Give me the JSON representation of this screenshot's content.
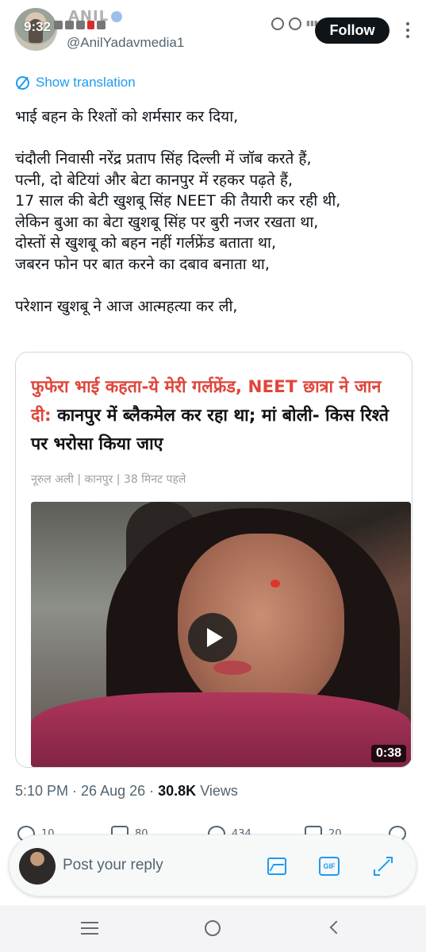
{
  "status_bar": {
    "time": "9:32"
  },
  "author": {
    "display_name": "ANIL",
    "handle": "@AnilYadavmedia1",
    "follow_label": "Follow"
  },
  "translation": {
    "label": "Show translation"
  },
  "tweet": {
    "lines": [
      "भाई बहन के रिश्तों को शर्मसार कर दिया,",
      "",
      "चंदौली निवासी नरेंद्र प्रताप सिंह दिल्ली में जॉब करते हैं,",
      "पत्नी, दो बेटियां और बेटा कानपुर में रहकर पढ़ते हैं,",
      "17 साल की बेटी खुशबू सिंह NEET की तैयारी कर रही थी,",
      "लेकिन बुआ का बेटा खुशबू सिंह पर बुरी नजर रखता था,",
      "दोस्तों से खुशबू को बहन नहीं गर्लफ्रेंड बताता था,",
      "जबरन फोन पर बात करने का दबाव बनाता था,",
      "",
      "परेशान खुशबू ने आज आत्महत्या कर ली,"
    ]
  },
  "card": {
    "headline_red": "फुफेरा भाई कहता-ये मेरी गर्लफ्रेंड, NEET छात्रा ने जान दी:",
    "headline_black": " कानपुर में ब्लैकमेल कर रहा था; मां बोली- किस रिश्ते पर भरोसा किया जाए",
    "meta": "नूरुल अली | कानपुर | 38 मिनट पहले",
    "video_duration": "0:38"
  },
  "timestamp": {
    "time": "5:10 PM",
    "sep": " · ",
    "date": "26 Aug 26",
    "sep2": " · ",
    "views": "30.8K",
    "views_label": " Views"
  },
  "actions": [
    {
      "name": "reply",
      "count": "10"
    },
    {
      "name": "retweet",
      "count": "80"
    },
    {
      "name": "like",
      "count": "434"
    },
    {
      "name": "bookmark",
      "count": "20"
    }
  ],
  "reply_bar": {
    "placeholder": "Post your reply",
    "gif_label": "GIF"
  },
  "colors": {
    "accent": "#1d9bf0",
    "headline_red": "#e0453a",
    "text": "#0f1419",
    "muted": "#536471"
  },
  "icons": [
    "globe-icon",
    "play-icon",
    "reply-icon",
    "retweet-icon",
    "like-icon",
    "bookmark-icon",
    "share-icon",
    "image-icon",
    "gif-icon",
    "expand-icon",
    "menu-icon",
    "home-icon",
    "back-icon"
  ]
}
